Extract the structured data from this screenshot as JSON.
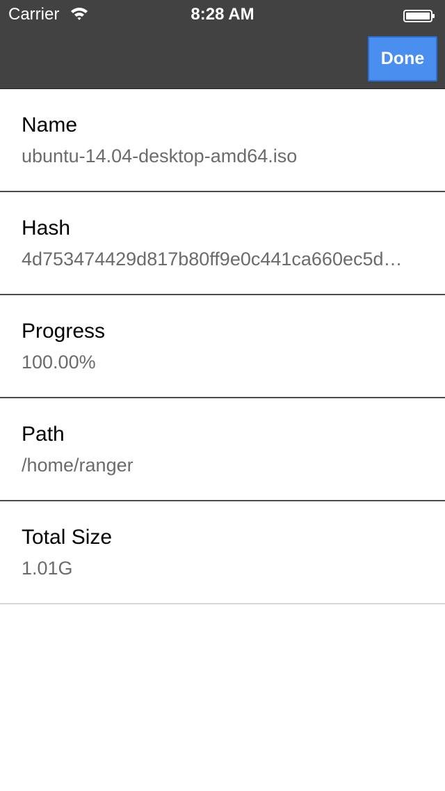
{
  "status_bar": {
    "carrier": "Carrier",
    "time": "8:28 AM",
    "wifi_icon": "wifi-icon",
    "battery_icon": "battery-icon"
  },
  "nav": {
    "done_label": "Done",
    "accent_color": "#4a8ff0"
  },
  "details": [
    {
      "label": "Name",
      "value": "ubuntu-14.04-desktop-amd64.iso"
    },
    {
      "label": "Hash",
      "value": "4d753474429d817b80ff9e0c441ca660ec5d…"
    },
    {
      "label": "Progress",
      "value": "100.00%"
    },
    {
      "label": "Path",
      "value": "/home/ranger"
    },
    {
      "label": "Total Size",
      "value": "1.01G"
    }
  ]
}
